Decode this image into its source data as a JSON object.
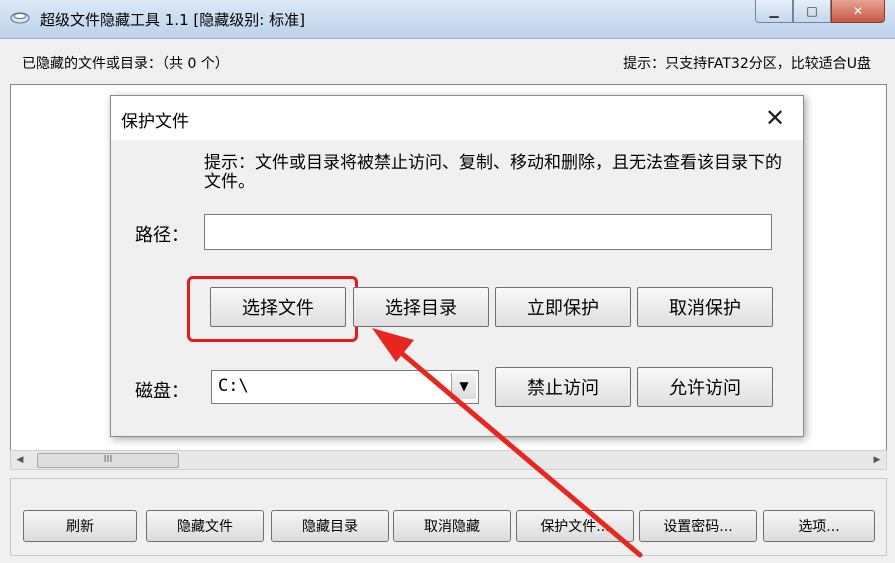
{
  "window": {
    "title": "超级文件隐藏工具 1.1 [隐藏级别: 标准]",
    "minimize_icon": "minimize-icon",
    "maximize_icon": "maximize-icon",
    "close_icon": "close-icon"
  },
  "infobar": {
    "hidden_list_label": "已隐藏的文件或目录：（共 0 个）",
    "tip": "提示：只支持FAT32分区，比较适合U盘"
  },
  "scrollbar": {
    "thumb_grip": "III"
  },
  "toolbar": {
    "refresh": "刷新",
    "hide_file": "隐藏文件",
    "hide_dir": "隐藏目录",
    "unhide": "取消隐藏",
    "protect_file": "保护文件...",
    "set_password": "设置密码...",
    "options": "选项..."
  },
  "dialog": {
    "title": "保护文件",
    "hint": "提示：文件或目录将被禁止访问、复制、移动和删除，且无法查看该目录下的文件。",
    "path_label": "路径：",
    "path_value": "",
    "select_file": "选择文件",
    "select_dir": "选择目录",
    "protect_now": "立即保护",
    "cancel_protect": "取消保护",
    "disk_label": "磁盘：",
    "disk_value": "C:\\",
    "deny_access": "禁止访问",
    "allow_access": "允许访问"
  },
  "colors": {
    "highlight": "#e31c1c",
    "titlebar": "#cfdef0"
  }
}
